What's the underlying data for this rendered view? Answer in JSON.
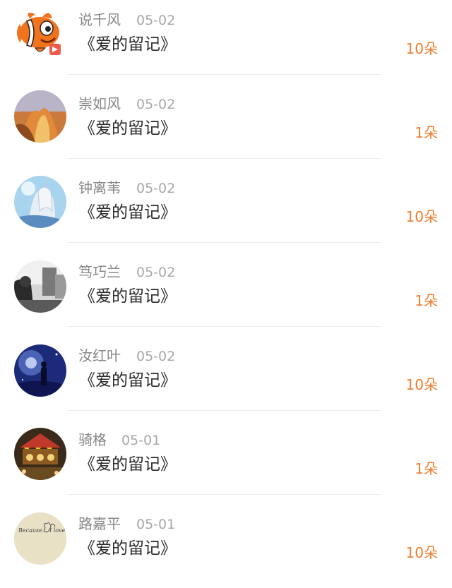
{
  "messages": [
    {
      "name": "说千风",
      "date": "05-02",
      "title": "《爱的留记》",
      "gift": "10朵",
      "avatar": "clownfish-avatar"
    },
    {
      "name": "崇如风",
      "date": "05-02",
      "title": "《爱的留记》",
      "gift": "1朵",
      "avatar": "abstract-orange-avatar"
    },
    {
      "name": "钟离苇",
      "date": "05-02",
      "title": "《爱的留记》",
      "gift": "10朵",
      "avatar": "anime-girl-avatar"
    },
    {
      "name": "笃巧兰",
      "date": "05-02",
      "title": "《爱的留记》",
      "gift": "1朵",
      "avatar": "street-photo-avatar"
    },
    {
      "name": "汝红叶",
      "date": "05-02",
      "title": "《爱的留记》",
      "gift": "10朵",
      "avatar": "night-sky-avatar"
    },
    {
      "name": "骑格",
      "date": "05-01",
      "title": "《爱的留记》",
      "gift": "1朵",
      "avatar": "carousel-avatar"
    },
    {
      "name": "路嘉平",
      "date": "05-01",
      "title": "《爱的留记》",
      "gift": "10朵",
      "avatar": "handwriting-avatar",
      "avatar_text": "Because... I love you..."
    }
  ],
  "colors": {
    "gift": "#f07d2c",
    "name": "#888888",
    "date": "#a8a8a8",
    "title": "#2b2b2b",
    "divider": "#ededed"
  }
}
